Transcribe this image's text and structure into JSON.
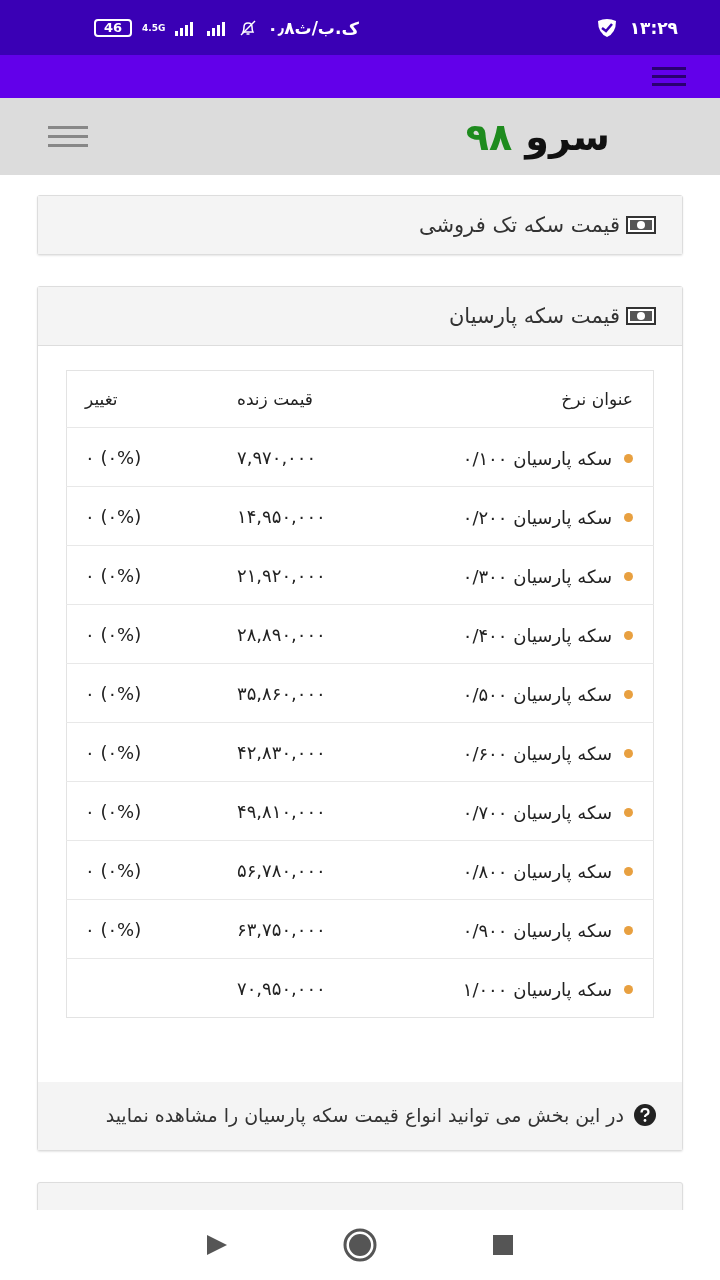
{
  "status_bar": {
    "time": "۱۳:۲۹",
    "network_speed": "۰٫۸ک.ب/ث",
    "network_type": "4.5G",
    "battery": "46"
  },
  "header": {
    "logo_text": "سرو",
    "logo_number": "۹۸"
  },
  "cards": [
    {
      "title": "قیمت سکه تک فروشی"
    }
  ],
  "price_card": {
    "title": "قیمت سکه پارسیان",
    "columns": [
      "عنوان نرخ",
      "قیمت زنده",
      "تغییر"
    ],
    "rows": [
      {
        "name": "سکه پارسیان ۰/۱۰۰",
        "price": "۷,۹۷۰,۰۰۰",
        "change": "۰ (۰%)"
      },
      {
        "name": "سکه پارسیان ۰/۲۰۰",
        "price": "۱۴,۹۵۰,۰۰۰",
        "change": "۰ (۰%)"
      },
      {
        "name": "سکه پارسیان ۰/۳۰۰",
        "price": "۲۱,۹۲۰,۰۰۰",
        "change": "۰ (۰%)"
      },
      {
        "name": "سکه پارسیان ۰/۴۰۰",
        "price": "۲۸,۸۹۰,۰۰۰",
        "change": "۰ (۰%)"
      },
      {
        "name": "سکه پارسیان ۰/۵۰۰",
        "price": "۳۵,۸۶۰,۰۰۰",
        "change": "۰ (۰%)"
      },
      {
        "name": "سکه پارسیان ۰/۶۰۰",
        "price": "۴۲,۸۳۰,۰۰۰",
        "change": "۰ (۰%)"
      },
      {
        "name": "سکه پارسیان ۰/۷۰۰",
        "price": "۴۹,۸۱۰,۰۰۰",
        "change": "۰ (۰%)"
      },
      {
        "name": "سکه پارسیان ۰/۸۰۰",
        "price": "۵۶,۷۸۰,۰۰۰",
        "change": "۰ (۰%)"
      },
      {
        "name": "سکه پارسیان ۰/۹۰۰",
        "price": "۶۳,۷۵۰,۰۰۰",
        "change": "۰ (۰%)"
      },
      {
        "name": "سکه پارسیان ۱/۰۰۰",
        "price": "۷۰,۹۵۰,۰۰۰"
      }
    ],
    "note": "در این بخش می توانید انواع قیمت سکه پارسیان را مشاهده نمایید"
  }
}
